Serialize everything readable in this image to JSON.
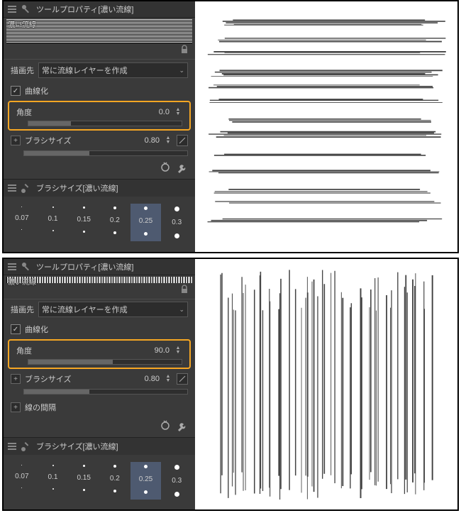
{
  "panels": [
    {
      "tool_property_title": "ツールプロパティ[濃い流線]",
      "preset_name": "濃い流線",
      "draw_target_label": "描画先",
      "draw_target_value": "常に流線レイヤーを作成",
      "curve_label": "曲線化",
      "curve_checked": true,
      "angle_label": "角度",
      "angle_value": "0.0",
      "brush_size_label": "ブラシサイズ",
      "brush_size_value": "0.80",
      "brush_list_title": "ブラシサイズ[濃い流線]",
      "brush_sizes": [
        "0.07",
        "0.1",
        "0.15",
        "0.2",
        "0.25",
        "0.3"
      ],
      "selected_brush_index": 4,
      "preview_orientation": "h"
    },
    {
      "tool_property_title": "ツールプロパティ[濃い流線]",
      "preset_name": "濃い流線",
      "draw_target_label": "描画先",
      "draw_target_value": "常に流線レイヤーを作成",
      "curve_label": "曲線化",
      "curve_checked": true,
      "angle_label": "角度",
      "angle_value": "90.0",
      "brush_size_label": "ブラシサイズ",
      "brush_size_value": "0.80",
      "gap_label": "線の間隔",
      "brush_list_title": "ブラシサイズ[濃い流線]",
      "brush_sizes": [
        "0.07",
        "0.1",
        "0.15",
        "0.2",
        "0.25",
        "0.3"
      ],
      "selected_brush_index": 4,
      "preview_orientation": "v"
    }
  ]
}
